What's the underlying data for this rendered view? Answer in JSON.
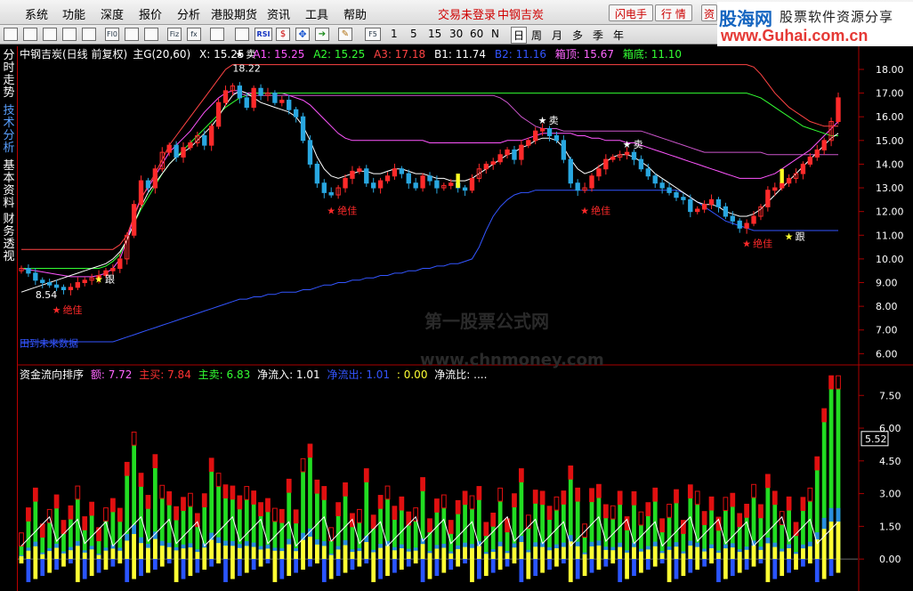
{
  "menubar": {
    "items": [
      "系统",
      "功能",
      "深度",
      "报价",
      "分析",
      "港股期货",
      "资讯",
      "工具",
      "帮助"
    ],
    "status": "交易未登录",
    "stock_title": "中钢吉炭",
    "buttons": [
      "闪电手",
      "行 情",
      "资"
    ]
  },
  "logo": {
    "site": "股海网",
    "tagline": "股票软件资源分享",
    "url": "www.Guhai.com.cn"
  },
  "toolbar": {
    "icons": [
      "app-icon",
      "grid-icon",
      "chart-icon",
      "list-icon",
      "table-icon",
      "f10-icon",
      "news-icon",
      "f10-doc-icon",
      "fiz-icon",
      "ta-icon",
      "tag-icon",
      "line-chart-icon",
      "rsi-icon",
      "dollar-icon",
      "move-icon",
      "export-icon",
      "pen-icon"
    ],
    "icon_labels": [
      "",
      "",
      "",
      "",
      "",
      "Fl0",
      "",
      "",
      "Fiz",
      "fx",
      "",
      "",
      "RSI",
      "$",
      "",
      "",
      ""
    ],
    "periods": [
      "F5",
      "1",
      "5",
      "15",
      "30",
      "60",
      "N",
      "日",
      "周",
      "月",
      "多",
      "季",
      "年"
    ]
  },
  "sidetabs": [
    "分时走势",
    "技术分析",
    "基本资料",
    "财务透视"
  ],
  "main_info": {
    "title": "中钢吉炭(日线 前复权)",
    "formula": "主G(20,60)",
    "items": [
      {
        "label": "X: 15.25",
        "color": "#ffffff"
      },
      {
        "label": "A1: 15.25",
        "color": "#ff55ff"
      },
      {
        "label": "A2: 15.25",
        "color": "#33ff33"
      },
      {
        "label": "A3: 17.18",
        "color": "#ff4444"
      },
      {
        "label": "B1: 11.74",
        "color": "#ffffff"
      },
      {
        "label": "B2: 11.16",
        "color": "#3355ff"
      },
      {
        "label": "箱顶: 15.67",
        "color": "#ff66ff"
      },
      {
        "label": "箱底: 11.10",
        "color": "#33ff33"
      }
    ]
  },
  "sub_info": {
    "title": "资金流向排序",
    "items": [
      {
        "label": "额: 7.72",
        "color": "#ff66ff"
      },
      {
        "label": "主买: 7.84",
        "color": "#ff3333"
      },
      {
        "label": "主卖: 6.83",
        "color": "#33ff33"
      },
      {
        "label": "净流入: 1.01",
        "color": "#ffffff"
      },
      {
        "label": "净流出: 1.01",
        "color": "#3355ff"
      },
      {
        "label": ": 0.00",
        "color": "#ffff33"
      },
      {
        "label": "净流比: ....",
        "color": "#ffffff"
      }
    ]
  },
  "annotations": {
    "sell": "卖",
    "follow": "跟",
    "best": "绝佳",
    "high_price": "18.22",
    "low_price": "8.54",
    "future_note": "田到未来数据"
  },
  "watermark": {
    "cn": "第一股票公式网",
    "en": "www.chnmoney.com"
  },
  "price_axis": {
    "ticks": [
      18.0,
      17.0,
      16.0,
      15.0,
      14.0,
      13.0,
      12.0,
      11.0,
      10.0,
      9.0,
      8.0,
      7.0,
      6.0
    ],
    "tick_labels": [
      "18.00",
      "17.00",
      "16.00",
      "15.00",
      "14.00",
      "13.00",
      "12.00",
      "11.00",
      "10.00",
      "9.00",
      "8.00",
      "7.00",
      "6.00"
    ]
  },
  "flow_axis": {
    "ticks": [
      7.5,
      6.0,
      4.5,
      3.0,
      1.5,
      0.0
    ],
    "tick_labels": [
      "7.50",
      "6.00",
      "4.50",
      "3.00",
      "1.50",
      "0.00"
    ],
    "cursor_value": "5.52"
  },
  "chart_data": {
    "type": "candlestick",
    "ylim": [
      5.6,
      18.6
    ],
    "closes": [
      9.6,
      9.4,
      9.1,
      9.0,
      8.9,
      8.8,
      8.7,
      8.8,
      9.0,
      9.1,
      9.2,
      9.3,
      9.5,
      9.6,
      10.0,
      11.0,
      12.3,
      13.3,
      13.0,
      13.8,
      14.5,
      14.8,
      14.3,
      14.7,
      14.9,
      15.2,
      14.8,
      15.6,
      16.6,
      17.1,
      17.3,
      16.8,
      16.4,
      17.2,
      16.9,
      17.0,
      16.6,
      16.7,
      16.3,
      16.0,
      15.0,
      14.0,
      13.2,
      12.8,
      12.7,
      13.0,
      13.4,
      13.7,
      13.8,
      13.2,
      13.0,
      13.3,
      13.5,
      13.8,
      13.6,
      13.2,
      13.0,
      13.5,
      13.3,
      13.0,
      13.1,
      13.2,
      13.0,
      12.9,
      13.4,
      13.8,
      14.0,
      14.1,
      14.4,
      14.6,
      14.2,
      14.8,
      15.0,
      15.4,
      15.5,
      15.2,
      15.0,
      14.2,
      13.2,
      12.9,
      13.0,
      13.5,
      13.8,
      14.2,
      14.3,
      14.4,
      14.5,
      14.2,
      13.8,
      13.5,
      13.2,
      13.0,
      12.8,
      12.6,
      12.5,
      12.0,
      12.1,
      12.3,
      12.5,
      12.2,
      11.8,
      11.6,
      11.3,
      11.5,
      11.8,
      12.2,
      12.9,
      13.0,
      13.2,
      13.4,
      13.6,
      14.0,
      14.3,
      14.6,
      15.0,
      15.8,
      16.8
    ],
    "series": [
      {
        "name": "A1",
        "values": [
          9.6,
          9.55,
          9.5,
          9.45,
          9.4,
          9.35,
          9.3,
          9.25,
          9.25,
          9.25,
          9.25,
          9.3,
          9.4,
          9.6,
          10.0,
          10.8,
          11.8,
          12.6,
          13.0,
          13.5,
          14.0,
          14.5,
          14.8,
          15.1,
          15.4,
          15.8,
          16.2,
          16.5,
          16.8,
          17.0,
          17.1,
          17.1,
          17.0,
          17.0,
          17.0,
          17.0,
          17.0,
          17.0,
          16.9,
          16.8,
          16.7,
          16.5,
          16.2,
          15.9,
          15.6,
          15.3,
          15.1,
          15.0,
          15.0,
          15.0,
          15.0,
          15.0,
          15.0,
          15.0,
          15.0,
          15.0,
          15.0,
          15.0,
          14.9,
          14.9,
          14.9,
          14.9,
          14.9,
          14.9,
          14.9,
          14.9,
          14.9,
          14.9,
          14.9,
          15.0,
          15.0,
          15.0,
          15.1,
          15.2,
          15.3,
          15.3,
          15.3,
          15.3,
          15.3,
          15.2,
          15.2,
          15.1,
          15.1,
          15.0,
          15.0,
          15.0,
          14.9,
          14.9,
          14.8,
          14.7,
          14.6,
          14.5,
          14.4,
          14.3,
          14.2,
          14.1,
          14.0,
          13.9,
          13.8,
          13.7,
          13.6,
          13.5,
          13.4,
          13.4,
          13.4,
          13.4,
          13.5,
          13.6,
          13.8,
          14.0,
          14.2,
          14.4,
          14.6,
          14.9,
          15.2,
          15.5,
          15.8
        ]
      },
      {
        "name": "A2",
        "values": [
          9.6,
          9.6,
          9.6,
          9.6,
          9.6,
          9.6,
          9.6,
          9.6,
          9.6,
          9.6,
          9.6,
          9.6,
          9.7,
          9.9,
          10.2,
          10.8,
          11.5,
          12.1,
          12.6,
          13.1,
          13.6,
          14.0,
          14.3,
          14.6,
          14.9,
          15.2,
          15.5,
          15.8,
          16.1,
          16.4,
          16.6,
          16.8,
          16.9,
          17.0,
          17.0,
          17.0,
          17.0,
          17.0,
          17.0,
          17.0,
          17.0,
          17.0,
          17.0,
          17.0,
          17.0,
          17.0,
          17.0,
          17.0,
          17.0,
          17.0,
          17.0,
          17.0,
          17.0,
          17.0,
          17.0,
          17.0,
          17.0,
          17.0,
          17.0,
          17.0,
          17.0,
          17.0,
          17.0,
          17.0,
          17.0,
          17.0,
          17.0,
          17.0,
          17.0,
          17.0,
          17.0,
          17.0,
          17.0,
          17.0,
          17.0,
          17.0,
          17.0,
          17.0,
          17.0,
          17.0,
          17.0,
          17.0,
          17.0,
          17.0,
          17.0,
          17.0,
          17.0,
          17.0,
          17.0,
          17.0,
          17.0,
          17.0,
          17.0,
          17.0,
          17.0,
          17.0,
          17.0,
          17.0,
          17.0,
          17.0,
          17.0,
          17.0,
          17.0,
          17.0,
          16.9,
          16.8,
          16.6,
          16.4,
          16.2,
          16.0,
          15.8,
          15.6,
          15.5,
          15.4,
          15.3,
          15.2,
          15.2
        ]
      },
      {
        "name": "A3",
        "values": [
          10.4,
          10.4,
          10.4,
          10.4,
          10.4,
          10.4,
          10.4,
          10.4,
          10.4,
          10.4,
          10.4,
          10.4,
          10.4,
          10.4,
          10.6,
          11.0,
          11.8,
          12.5,
          13.1,
          13.6,
          14.2,
          14.8,
          15.2,
          15.6,
          16.0,
          16.4,
          16.8,
          17.2,
          17.6,
          18.0,
          18.2,
          18.2,
          18.2,
          18.2,
          18.2,
          18.2,
          18.2,
          18.2,
          18.2,
          18.2,
          18.2,
          18.2,
          18.2,
          18.2,
          18.2,
          18.2,
          18.2,
          18.2,
          18.2,
          18.2,
          18.2,
          18.2,
          18.2,
          18.2,
          18.2,
          18.2,
          18.2,
          18.2,
          18.2,
          18.2,
          18.2,
          18.2,
          18.2,
          18.2,
          18.2,
          18.2,
          18.2,
          18.2,
          18.2,
          18.2,
          18.2,
          18.2,
          18.2,
          18.2,
          18.2,
          18.2,
          18.2,
          18.2,
          18.2,
          18.2,
          18.2,
          18.2,
          18.2,
          18.2,
          18.2,
          18.2,
          18.2,
          18.2,
          18.2,
          18.2,
          18.2,
          18.2,
          18.2,
          18.2,
          18.2,
          18.2,
          18.2,
          18.2,
          18.2,
          18.2,
          18.2,
          18.2,
          18.2,
          18.2,
          18.1,
          17.8,
          17.4,
          17.0,
          16.7,
          16.4,
          16.2,
          16.0,
          15.8,
          15.7,
          15.6,
          15.6,
          15.6
        ]
      },
      {
        "name": "箱顶",
        "values": [
          null,
          null,
          null,
          null,
          null,
          null,
          null,
          null,
          null,
          null,
          null,
          null,
          null,
          null,
          null,
          null,
          null,
          null,
          null,
          null,
          null,
          null,
          null,
          null,
          null,
          null,
          null,
          null,
          null,
          null,
          17.0,
          17.0,
          16.9,
          16.9,
          16.9,
          16.9,
          16.9,
          16.9,
          16.9,
          16.9,
          16.9,
          16.9,
          16.9,
          16.9,
          16.9,
          16.9,
          16.9,
          16.9,
          16.9,
          16.9,
          16.9,
          16.9,
          16.9,
          16.9,
          16.9,
          16.9,
          16.9,
          16.9,
          16.9,
          16.9,
          16.9,
          16.9,
          16.9,
          16.9,
          16.9,
          16.9,
          16.9,
          16.9,
          16.8,
          16.6,
          16.3,
          16.0,
          15.8,
          15.6,
          15.5,
          15.5,
          15.5,
          15.4,
          15.4,
          15.4,
          15.4,
          15.4,
          15.4,
          15.4,
          15.4,
          15.4,
          15.4,
          15.4,
          15.4,
          15.3,
          15.2,
          15.1,
          15.0,
          14.9,
          14.8,
          14.7,
          14.6,
          14.5,
          14.5,
          14.5,
          14.5,
          14.5,
          14.5,
          14.5,
          14.5,
          14.5,
          14.4,
          14.4,
          14.4,
          14.4,
          14.4,
          14.4,
          14.4,
          14.4,
          14.4,
          14.4,
          14.4
        ]
      },
      {
        "name": "B2",
        "values": [
          6.5,
          6.5,
          6.5,
          6.5,
          6.5,
          6.5,
          6.5,
          6.5,
          6.5,
          6.5,
          6.5,
          6.5,
          6.5,
          6.5,
          6.6,
          6.7,
          6.8,
          6.9,
          7.0,
          7.1,
          7.2,
          7.3,
          7.4,
          7.5,
          7.6,
          7.7,
          7.8,
          7.9,
          8.0,
          8.1,
          8.2,
          8.3,
          8.3,
          8.4,
          8.4,
          8.5,
          8.5,
          8.6,
          8.6,
          8.6,
          8.7,
          8.7,
          8.8,
          8.9,
          8.9,
          9.0,
          9.0,
          9.1,
          9.1,
          9.2,
          9.2,
          9.3,
          9.3,
          9.4,
          9.4,
          9.5,
          9.5,
          9.6,
          9.6,
          9.7,
          9.7,
          9.8,
          9.8,
          9.9,
          10.0,
          10.5,
          11.2,
          11.8,
          12.2,
          12.5,
          12.7,
          12.8,
          12.8,
          12.9,
          12.9,
          12.9,
          12.9,
          12.9,
          12.9,
          12.9,
          12.9,
          12.9,
          12.9,
          12.9,
          12.9,
          12.9,
          12.9,
          12.9,
          12.9,
          12.9,
          12.9,
          12.9,
          12.9,
          12.9,
          12.8,
          12.6,
          12.4,
          12.2,
          12.0,
          11.8,
          11.6,
          11.5,
          11.4,
          11.3,
          11.2,
          11.2,
          11.2,
          11.2,
          11.2,
          11.2,
          11.2,
          11.2,
          11.2,
          11.2,
          11.2,
          11.2,
          11.2
        ]
      },
      {
        "name": "B1",
        "values": [
          8.6,
          8.7,
          8.8,
          8.9,
          9.0,
          9.1,
          9.2,
          9.3,
          9.4,
          9.5,
          9.6,
          9.7,
          9.8,
          10.0,
          10.3,
          10.8,
          11.5,
          12.2,
          12.8,
          13.2,
          13.6,
          14.0,
          14.3,
          14.5,
          14.7,
          15.0,
          15.3,
          15.6,
          16.0,
          16.5,
          16.9,
          17.1,
          17.0,
          16.8,
          16.6,
          16.5,
          16.4,
          16.3,
          16.2,
          16.0,
          15.6,
          15.0,
          14.3,
          13.8,
          13.5,
          13.4,
          13.5,
          13.6,
          13.7,
          13.7,
          13.6,
          13.6,
          13.7,
          13.8,
          13.8,
          13.7,
          13.6,
          13.6,
          13.5,
          13.4,
          13.4,
          13.3,
          13.3,
          13.3,
          13.4,
          13.6,
          13.8,
          14.0,
          14.2,
          14.4,
          14.5,
          14.7,
          14.8,
          15.0,
          15.1,
          15.1,
          15.0,
          14.7,
          14.2,
          13.8,
          13.6,
          13.7,
          13.9,
          14.1,
          14.3,
          14.4,
          14.4,
          14.3,
          14.1,
          13.9,
          13.6,
          13.4,
          13.2,
          13.0,
          12.8,
          12.6,
          12.4,
          12.3,
          12.3,
          12.2,
          12.0,
          11.9,
          11.8,
          11.8,
          11.9,
          12.1,
          12.4,
          12.7,
          13.0,
          13.3,
          13.6,
          13.9,
          14.2,
          14.5,
          14.8,
          15.1,
          15.3
        ]
      }
    ],
    "flow_bars": {
      "max": 7.84,
      "ylim": [
        -1.3,
        8.0
      ]
    }
  }
}
